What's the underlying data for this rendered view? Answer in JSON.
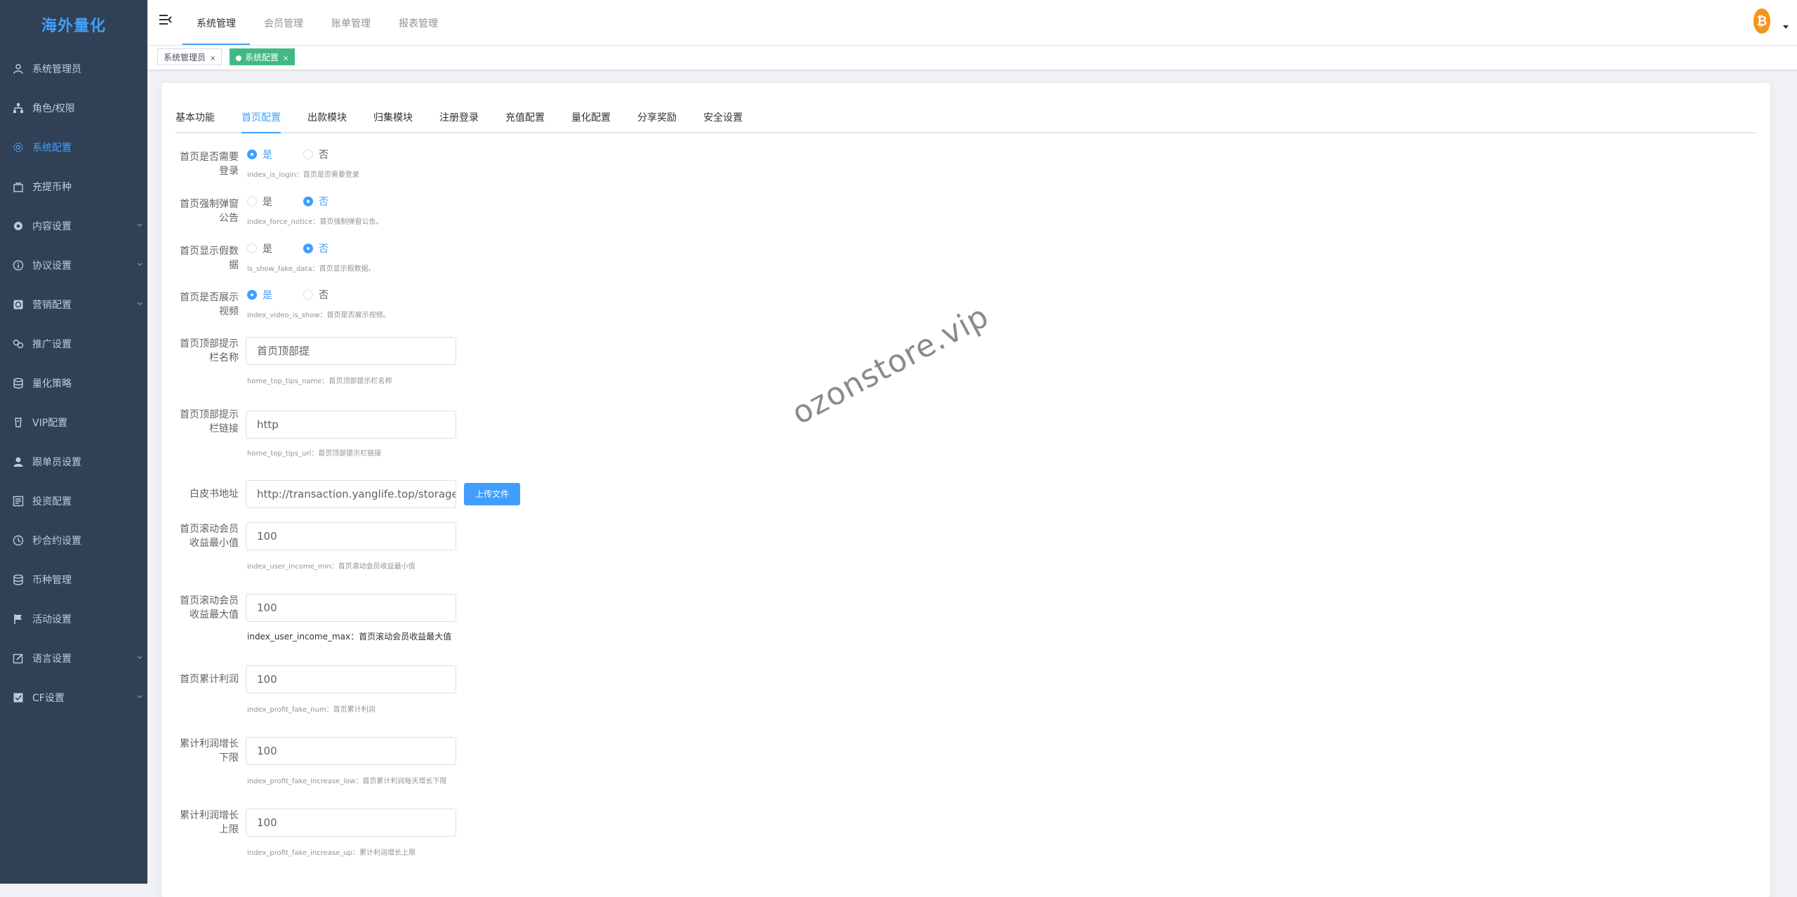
{
  "app": {
    "logo": "海外量化"
  },
  "sidebar": {
    "items": [
      {
        "label": "系统管理员",
        "icon": "user-icon"
      },
      {
        "label": "角色/权限",
        "icon": "tree-icon"
      },
      {
        "label": "系统配置",
        "icon": "gear-icon",
        "active": true
      },
      {
        "label": "充提币种",
        "icon": "bag-icon"
      },
      {
        "label": "内容设置",
        "icon": "cog-filled-icon",
        "expandable": true
      },
      {
        "label": "协议设置",
        "icon": "info-icon",
        "expandable": true
      },
      {
        "label": "营销配置",
        "icon": "chart-box-icon",
        "expandable": true
      },
      {
        "label": "推广设置",
        "icon": "share-icon"
      },
      {
        "label": "量化策略",
        "icon": "database-icon"
      },
      {
        "label": "VIP配置",
        "icon": "cup-icon"
      },
      {
        "label": "跟单员设置",
        "icon": "person-icon"
      },
      {
        "label": "投资配置",
        "icon": "form-icon"
      },
      {
        "label": "秒合约设置",
        "icon": "clock-icon"
      },
      {
        "label": "币种管理",
        "icon": "database-icon"
      },
      {
        "label": "活动设置",
        "icon": "flag-icon"
      },
      {
        "label": "语言设置",
        "icon": "edit-icon",
        "expandable": true
      },
      {
        "label": "CF设置",
        "icon": "check-icon",
        "expandable": true
      }
    ]
  },
  "header": {
    "tabs": [
      {
        "label": "系统管理",
        "active": true
      },
      {
        "label": "会员管理"
      },
      {
        "label": "账单管理"
      },
      {
        "label": "报表管理"
      }
    ],
    "coin_glyph": "₿"
  },
  "tags": [
    {
      "label": "系统管理员",
      "close": "×"
    },
    {
      "label": "系统配置",
      "close": "×",
      "active": true
    }
  ],
  "subtabs": [
    {
      "label": "基本功能"
    },
    {
      "label": "首页配置",
      "active": true
    },
    {
      "label": "出款模块"
    },
    {
      "label": "归集模块"
    },
    {
      "label": "注册登录"
    },
    {
      "label": "充值配置"
    },
    {
      "label": "量化配置"
    },
    {
      "label": "分享奖励"
    },
    {
      "label": "安全设置"
    }
  ],
  "form": {
    "opt_yes": "是",
    "opt_no": "否",
    "index_login": {
      "label": "首页是否需要登录",
      "value": "是",
      "hint": "index_is_login：首页是否需要登录"
    },
    "force_notice": {
      "label": "首页强制弹窗公告",
      "value": "否",
      "hint": "index_force_notice：首页强制弹窗公告。"
    },
    "fake_data": {
      "label": "首页显示假数据",
      "value": "否",
      "hint": "is_show_fake_data：首页显示假数据。"
    },
    "video_show": {
      "label": "首页是否展示视频",
      "value": "是",
      "hint": "index_video_is_show：首页是否展示视频。"
    },
    "top_tips_name": {
      "label": "首页顶部提示栏名称",
      "value": "首页顶部提",
      "hint": "home_top_tips_name：首页顶部提示栏名称"
    },
    "top_tips_url": {
      "label": "首页顶部提示栏链接",
      "value": "http",
      "hint": "home_top_tips_url：首页顶部提示栏链接"
    },
    "whitepaper": {
      "label": "白皮书地址",
      "value": "http://transaction.yanglife.top/storage/whitepaper.pdf",
      "button": "上传文件"
    },
    "income_min": {
      "label": "首页滚动会员收益最小值",
      "value": "100",
      "hint": "index_user_income_min：首页滚动会员收益最小值"
    },
    "income_max": {
      "label": "首页滚动会员收益最大值",
      "value": "100",
      "hint": "index_user_income_max：首页滚动会员收益最大值"
    },
    "profit_num": {
      "label": "首页累计利润",
      "value": "100",
      "hint": "index_profit_fake_num：首页累计利润"
    },
    "increase_low": {
      "label": "累计利润增长下限",
      "value": "100",
      "hint": "index_profit_fake_increase_low：首页累计利润每天增长下限"
    },
    "increase_up": {
      "label": "累计利润增长上限",
      "value": "100",
      "hint": "index_profit_fake_increase_up：累计利润增长上限"
    }
  },
  "watermark": "ozonstore.vip"
}
